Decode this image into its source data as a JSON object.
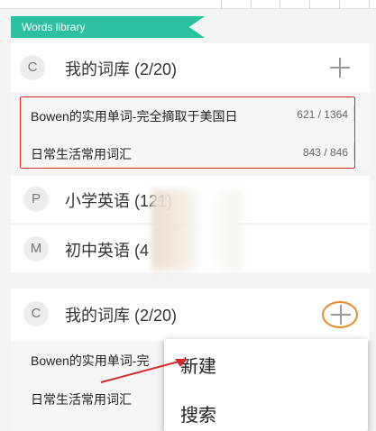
{
  "section_tag": "Words library",
  "panel1": {
    "my_lib": {
      "letter": "C",
      "title": "我的词库 (2/20)"
    },
    "items": [
      {
        "name": "Bowen的实用单词-完全摘取于美国日",
        "count": "621 / 1364"
      },
      {
        "name": "日常生活常用词汇",
        "count": "843 / 846"
      }
    ],
    "primary": {
      "letter": "P",
      "title": "小学英语 (121)"
    },
    "middle": {
      "letter": "M",
      "title": "初中英语 (4"
    }
  },
  "panel2": {
    "my_lib": {
      "letter": "C",
      "title": "我的词库 (2/20)"
    },
    "items": [
      {
        "name": "Bowen的实用单词-完"
      },
      {
        "name": "日常生活常用词汇"
      }
    ],
    "menu": [
      {
        "label": "新建"
      },
      {
        "label": "搜索"
      }
    ]
  },
  "colors": {
    "accent_tag": "#2bc0a0",
    "highlight_box": "#d62a2a",
    "highlight_ring": "#e88a2e",
    "arrow": "#d62a2a"
  }
}
